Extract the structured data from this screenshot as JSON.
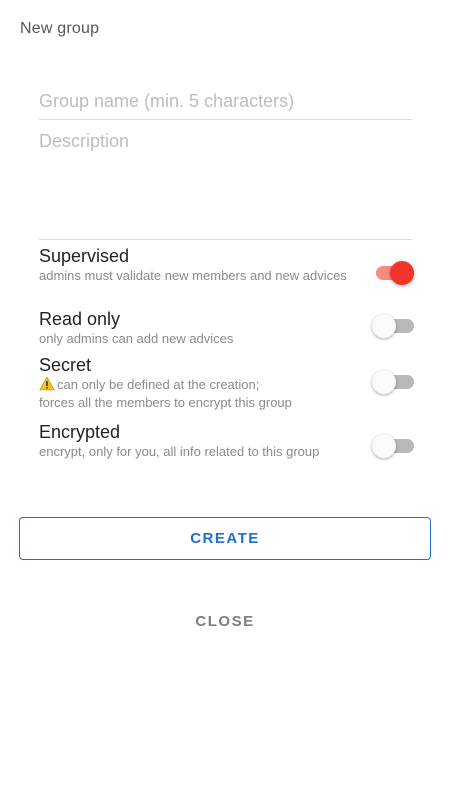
{
  "dialog": {
    "title": "New group"
  },
  "fields": {
    "name_placeholder": "Group name (min. 5 characters)",
    "description_placeholder": "Description"
  },
  "options": [
    {
      "title": "Supervised",
      "subtitle": "admins must validate new members and new advices",
      "enabled": true
    },
    {
      "title": "Read only",
      "subtitle": "only admins can add new advices",
      "enabled": false
    },
    {
      "title": "Secret",
      "subtitle": "can only be defined at the creation;",
      "subtitle_line2": "forces all the members to encrypt this group",
      "icon": "warning-icon",
      "enabled": false
    },
    {
      "title": "Encrypted",
      "subtitle": "encrypt, only for you, all info related to this group",
      "enabled": false
    }
  ],
  "actions": {
    "create_label": "CREATE",
    "close_label": "CLOSE"
  },
  "colors": {
    "accent": "#1e6fd1",
    "toggle_on": "#f5332b",
    "toggle_on_track": "#f98a82",
    "toggle_off_track": "#b9b9b9",
    "warning": "#f5c518"
  }
}
